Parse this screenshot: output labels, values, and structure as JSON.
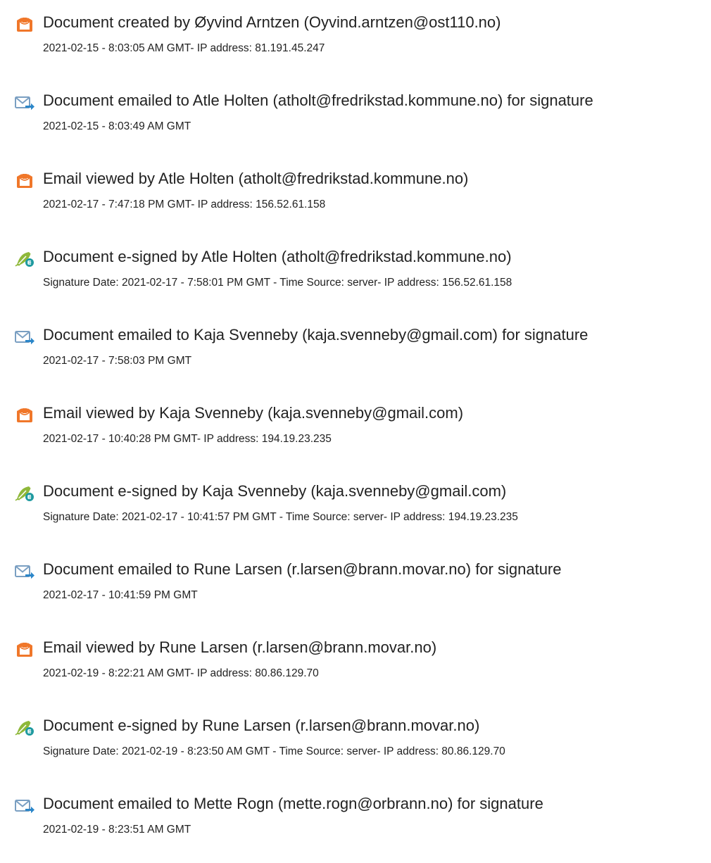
{
  "colors": {
    "view_icon": "#f0772a",
    "email_icon": "#7a9fc2",
    "email_arrow": "#2b86c9",
    "sign_icon": "#8fb83a",
    "sign_badge": "#1f9aa0",
    "text": "#222222"
  },
  "events": [
    {
      "icon": "document-view-icon",
      "title": "Document created by Øyvind Arntzen (Oyvind.arntzen@ost110.no)",
      "detail": "2021-02-15 - 8:03:05 AM GMT- IP address: 81.191.45.247"
    },
    {
      "icon": "email-sent-icon",
      "title": "Document emailed to Atle Holten (atholt@fredrikstad.kommune.no) for signature",
      "detail": "2021-02-15 - 8:03:49 AM GMT"
    },
    {
      "icon": "document-view-icon",
      "title": "Email viewed by Atle Holten (atholt@fredrikstad.kommune.no)",
      "detail": "2021-02-17 - 7:47:18 PM GMT- IP address: 156.52.61.158"
    },
    {
      "icon": "pen-signature-icon",
      "title": "Document e-signed by Atle Holten (atholt@fredrikstad.kommune.no)",
      "detail": "Signature Date: 2021-02-17 - 7:58:01 PM GMT - Time Source: server- IP address: 156.52.61.158"
    },
    {
      "icon": "email-sent-icon",
      "title": "Document emailed to Kaja Svenneby (kaja.svenneby@gmail.com) for signature",
      "detail": "2021-02-17 - 7:58:03 PM GMT"
    },
    {
      "icon": "document-view-icon",
      "title": "Email viewed by Kaja Svenneby (kaja.svenneby@gmail.com)",
      "detail": "2021-02-17 - 10:40:28 PM GMT- IP address: 194.19.23.235"
    },
    {
      "icon": "pen-signature-icon",
      "title": "Document e-signed by Kaja Svenneby (kaja.svenneby@gmail.com)",
      "detail": "Signature Date: 2021-02-17 - 10:41:57 PM GMT - Time Source: server- IP address: 194.19.23.235"
    },
    {
      "icon": "email-sent-icon",
      "title": "Document emailed to Rune Larsen (r.larsen@brann.movar.no) for signature",
      "detail": "2021-02-17 - 10:41:59 PM GMT"
    },
    {
      "icon": "document-view-icon",
      "title": "Email viewed by Rune Larsen (r.larsen@brann.movar.no)",
      "detail": "2021-02-19 - 8:22:21 AM GMT- IP address: 80.86.129.70"
    },
    {
      "icon": "pen-signature-icon",
      "title": "Document e-signed by Rune Larsen (r.larsen@brann.movar.no)",
      "detail": "Signature Date: 2021-02-19 - 8:23:50 AM GMT - Time Source: server- IP address: 80.86.129.70"
    },
    {
      "icon": "email-sent-icon",
      "title": "Document emailed to Mette Rogn (mette.rogn@orbrann.no) for signature",
      "detail": "2021-02-19 - 8:23:51 AM GMT"
    }
  ]
}
